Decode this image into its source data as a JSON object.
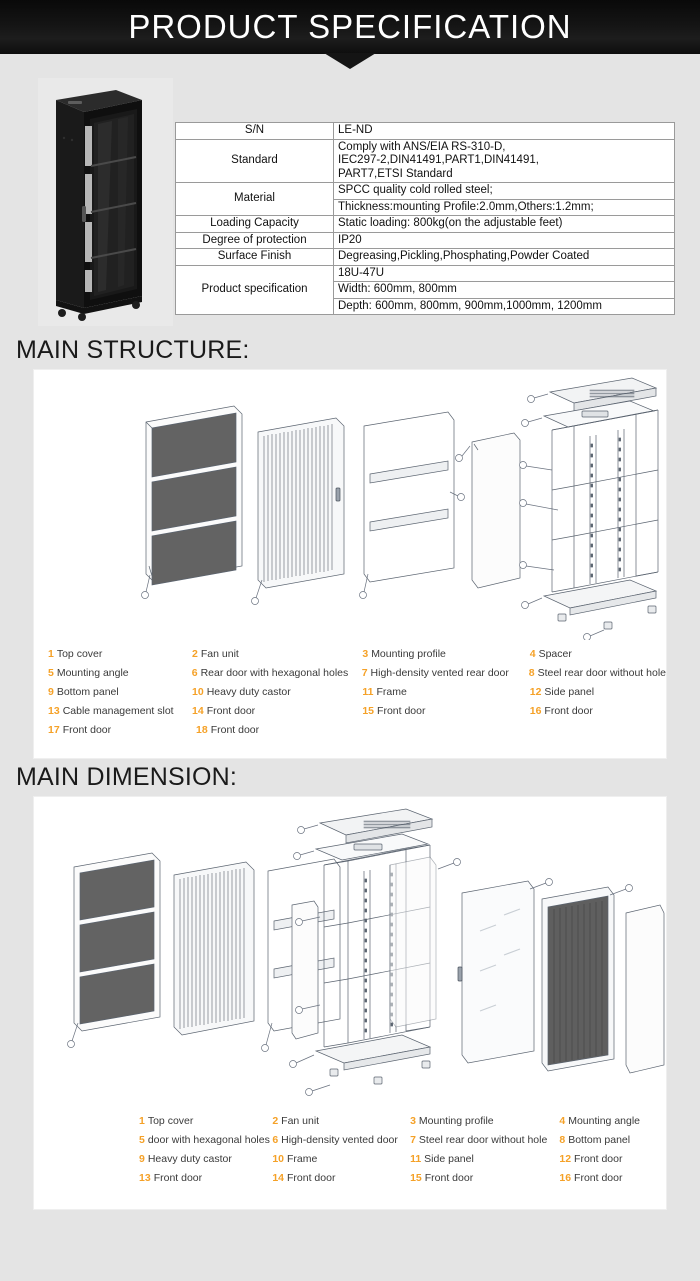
{
  "header": {
    "title": "PRODUCT SPECIFICATION"
  },
  "product_photo": {
    "alt": "black server rack cabinet"
  },
  "spec_table": {
    "rows": [
      {
        "key": "S/N",
        "values": [
          "LE-ND"
        ]
      },
      {
        "key": "Standard",
        "values": [
          "Comply with  ANS/EIA RS-310-D,",
          "IEC297-2,DIN41491,PART1,DIN41491,",
          "PART7,ETSI Standard"
        ]
      },
      {
        "key": "Material",
        "values": [
          "SPCC quality cold rolled steel;",
          "Thickness:mounting Profile:2.0mm,Others:1.2mm;"
        ]
      },
      {
        "key": "Loading Capacity",
        "values": [
          "Static loading: 800kg(on the adjustable feet)"
        ]
      },
      {
        "key": "Degree of protection",
        "values": [
          "IP20"
        ]
      },
      {
        "key": "Surface Finish",
        "values": [
          "Degreasing,Pickling,Phosphating,Powder Coated"
        ]
      },
      {
        "key": "Product specification",
        "values": [
          "18U-47U",
          "Width:  600mm, 800mm",
          "Depth:  600mm,  800mm,  900mm,1000mm,  1200mm"
        ]
      }
    ]
  },
  "sections": [
    {
      "heading": "MAIN STRUCTURE:",
      "legend": [
        {
          "num": "1",
          "label": "Top cover"
        },
        {
          "num": "2",
          "label": "Fan unit"
        },
        {
          "num": "3",
          "label": "Mounting profile"
        },
        {
          "num": "4",
          "label": "Spacer"
        },
        {
          "num": "5",
          "label": "Mounting angle"
        },
        {
          "num": "6",
          "label": "Rear door with hexagonal holes"
        },
        {
          "num": "7",
          "label": "High-density vented rear door"
        },
        {
          "num": "8",
          "label": "Steel rear door without hole"
        },
        {
          "num": "9",
          "label": "Bottom panel"
        },
        {
          "num": "10",
          "label": "Heavy duty castor"
        },
        {
          "num": "11",
          "label": "Frame"
        },
        {
          "num": "12",
          "label": "Side panel"
        },
        {
          "num": "13",
          "label": "Cable management slot"
        },
        {
          "num": "14",
          "label": "Front door"
        },
        {
          "num": "15",
          "label": "Front door"
        },
        {
          "num": "16",
          "label": "Front door"
        },
        {
          "num": "17",
          "label": "Front door"
        },
        {
          "num": "18",
          "label": "Front door"
        }
      ]
    },
    {
      "heading": "MAIN DIMENSION:",
      "legend": [
        {
          "num": "1",
          "label": "Top cover"
        },
        {
          "num": "2",
          "label": "Fan unit"
        },
        {
          "num": "3",
          "label": "Mounting profile"
        },
        {
          "num": "4",
          "label": "Mounting angle"
        },
        {
          "num": "5",
          "label": "door with hexagonal holes"
        },
        {
          "num": "6",
          "label": "High-density vented door"
        },
        {
          "num": "7",
          "label": "Steel rear door without hole"
        },
        {
          "num": "8",
          "label": "Bottom panel"
        },
        {
          "num": "9",
          "label": "Heavy duty castor"
        },
        {
          "num": "10",
          "label": "Frame"
        },
        {
          "num": "11",
          "label": "Side panel"
        },
        {
          "num": "12",
          "label": "Front door"
        },
        {
          "num": "13",
          "label": "Front door"
        },
        {
          "num": "14",
          "label": "Front door"
        },
        {
          "num": "15",
          "label": "Front door"
        },
        {
          "num": "16",
          "label": "Front door"
        }
      ]
    }
  ],
  "colors": {
    "banner_bg": "#141414",
    "page_bg": "#e4e4e4",
    "legend_number": "#f5a127",
    "legend_text": "#3a3a3a",
    "panel_bg": "#ffffff"
  }
}
